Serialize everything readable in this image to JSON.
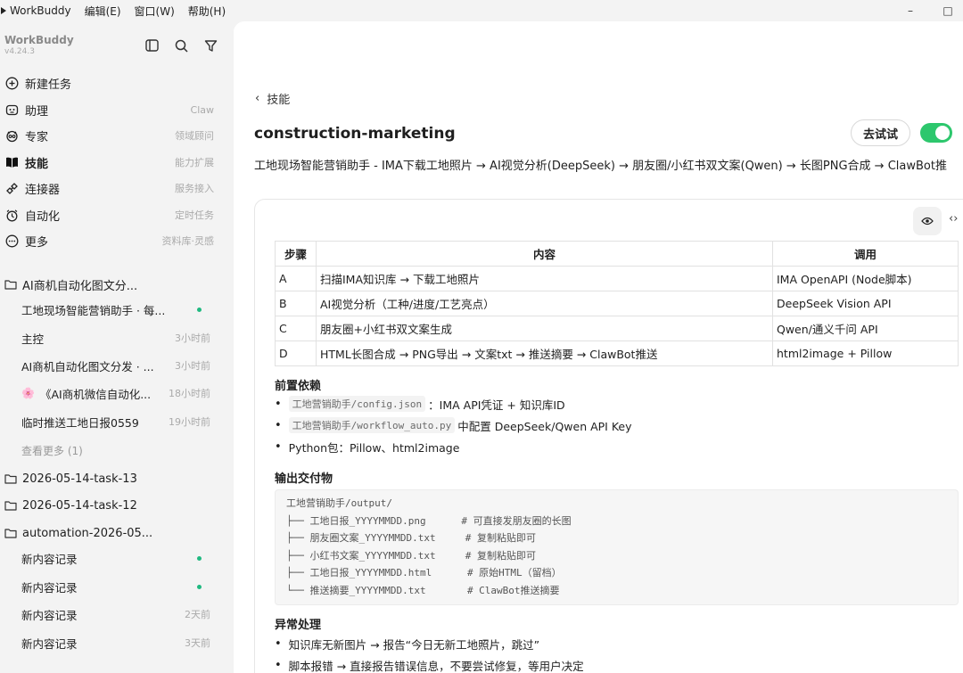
{
  "menubar": {
    "app": "WorkBuddy",
    "items": [
      "编辑(E)",
      "窗口(W)",
      "帮助(H)"
    ],
    "minimize": "–",
    "maximize": "□"
  },
  "sidebar": {
    "brand": "WorkBuddy",
    "version": "v4.24.3",
    "nav": [
      {
        "label": "新建任务",
        "hint": "",
        "icon": "plus-circle-icon"
      },
      {
        "label": "助理",
        "hint": "Claw",
        "icon": "assistant-icon"
      },
      {
        "label": "专家",
        "hint": "领域顾问",
        "icon": "expert-icon"
      },
      {
        "label": "技能",
        "hint": "能力扩展",
        "icon": "book-icon",
        "active": true
      },
      {
        "label": "连接器",
        "hint": "服务接入",
        "icon": "connector-icon"
      },
      {
        "label": "自动化",
        "hint": "定时任务",
        "icon": "alarm-icon"
      },
      {
        "label": "更多",
        "hint": "资料库·灵感",
        "icon": "more-icon"
      }
    ],
    "groups": [
      {
        "label": "AI商机自动化图文分..."
      },
      {
        "label": "2026-05-14-task-13"
      },
      {
        "label": "2026-05-14-task-12"
      },
      {
        "label": "automation-2026-05..."
      }
    ],
    "group1_tasks": [
      {
        "title": "工地现场智能营销助手 · 每...",
        "time": "",
        "dot": true
      },
      {
        "title": "主控",
        "time": "3小时前"
      },
      {
        "title": "AI商机自动化图文分发 · ...",
        "time": "3小时前"
      },
      {
        "title": "《AI商机微信自动化...",
        "time": "18小时前",
        "emoji": "🌸"
      },
      {
        "title": "临时推送工地日报0559",
        "time": "19小时前"
      }
    ],
    "see_more": "查看更多 (1)",
    "group4_tasks": [
      {
        "title": "新内容记录",
        "time": "",
        "dot": true
      },
      {
        "title": "新内容记录",
        "time": "",
        "dot": true
      },
      {
        "title": "新内容记录",
        "time": "2天前"
      },
      {
        "title": "新内容记录",
        "time": "3天前"
      }
    ]
  },
  "main": {
    "back_label": "技能",
    "title": "construction-marketing",
    "try_button": "去试试",
    "toggle_on": true,
    "description": "工地现场智能营销助手 - IMA下载工地照片 → AI视觉分析(DeepSeek) → 朋友圈/小红书双文案(Qwen) → 长图PNG合成 → ClawBot推",
    "table": {
      "headers": [
        "步骤",
        "内容",
        "调用"
      ],
      "rows": [
        [
          "A",
          "扫描IMA知识库 → 下载工地照片",
          "IMA OpenAPI (Node脚本)"
        ],
        [
          "B",
          "AI视觉分析（工种/进度/工艺亮点）",
          "DeepSeek Vision API"
        ],
        [
          "C",
          "朋友圈+小红书双文案生成",
          "Qwen/通义千问 API"
        ],
        [
          "D",
          "HTML长图合成 → PNG导出 → 文案txt → 推送摘要 → ClawBot推送",
          "html2image + Pillow"
        ]
      ]
    },
    "prereq": {
      "title": "前置依赖",
      "items": [
        {
          "code": "工地营销助手/config.json",
          "text": "：IMA API凭证 + 知识库ID"
        },
        {
          "code": "工地营销助手/workflow_auto.py",
          "text": "中配置 DeepSeek/Qwen API Key"
        },
        {
          "code": "",
          "text": "Python包：Pillow、html2image"
        }
      ]
    },
    "output": {
      "title": "输出交付物",
      "lines": [
        "工地营销助手/output/",
        "├── 工地日报_YYYYMMDD.png      # 可直接发朋友圈的长图",
        "├── 朋友圈文案_YYYYMMDD.txt     # 复制粘贴即可",
        "├── 小红书文案_YYYYMMDD.txt     # 复制粘贴即可",
        "├── 工地日报_YYYYMMDD.html      # 原始HTML（留档）",
        "└── 推送摘要_YYYYMMDD.txt       # ClawBot推送摘要"
      ]
    },
    "errors": {
      "title": "异常处理",
      "items": [
        {
          "text": "知识库无新图片 → 报告“今日无新工地照片，跳过”"
        },
        {
          "text": "脚本报错 → 直接报告错误信息，不要尝试修复，等用户决定"
        }
      ]
    }
  },
  "colors": {
    "accent_green": "#2dc76d",
    "status_dot": "#1fb980"
  }
}
